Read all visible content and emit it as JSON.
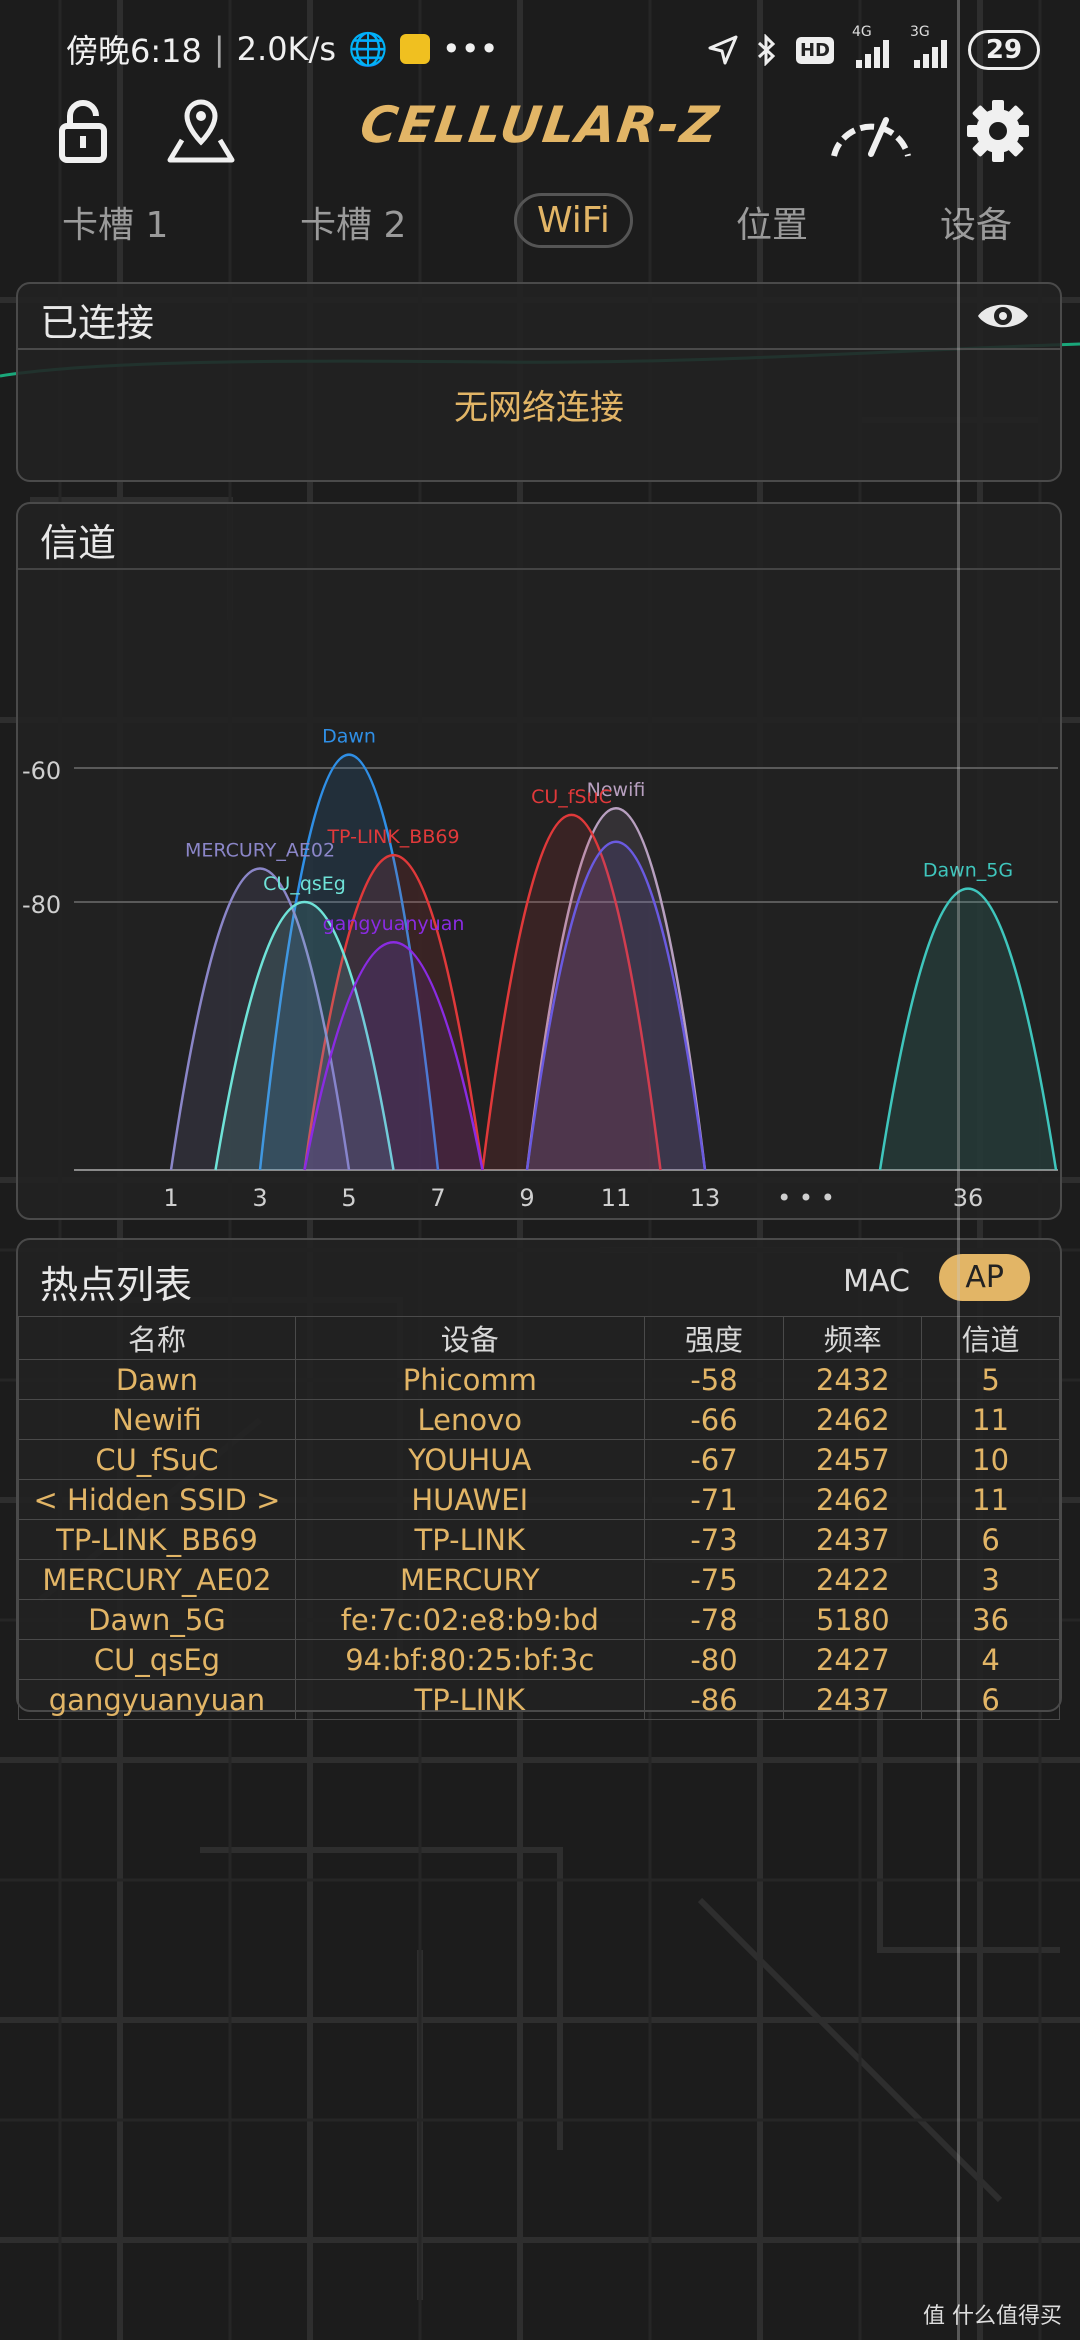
{
  "status_bar": {
    "time": "傍晚6:18",
    "net_speed": "2.0K/s",
    "more": "•••",
    "net1_label": "4G",
    "net2_label": "3G",
    "hd_label": "HD",
    "battery": "29"
  },
  "app": {
    "title": "CELLULAR-Z"
  },
  "tabs": [
    {
      "label": "卡槽 1"
    },
    {
      "label": "卡槽 2"
    },
    {
      "label": "WiFi"
    },
    {
      "label": "位置"
    },
    {
      "label": "设备"
    }
  ],
  "active_tab": "WiFi",
  "connected": {
    "title": "已连接",
    "status": "无网络连接"
  },
  "channel": {
    "title": "信道"
  },
  "chart_data": {
    "type": "area",
    "y_ticks": [
      "-60",
      "-80"
    ],
    "x_ticks": [
      "1",
      "3",
      "5",
      "7",
      "9",
      "11",
      "13",
      "• • •",
      "36"
    ],
    "y_range": [
      -100,
      -40
    ],
    "series": [
      {
        "name": "Dawn",
        "channel": 5,
        "rssi": -58,
        "color": "#2f8fe6"
      },
      {
        "name": "Newifi",
        "channel": 11,
        "rssi": -66,
        "color": "#b8a0c0"
      },
      {
        "name": "CU_fSuC",
        "channel": 10,
        "rssi": -67,
        "color": "#e0393a"
      },
      {
        "name": "",
        "channel": 11,
        "rssi": -71,
        "color": "#6a5ae0"
      },
      {
        "name": "TP-LINK_BB69",
        "channel": 6,
        "rssi": -73,
        "color": "#e0393a"
      },
      {
        "name": "MERCURY_AE02",
        "channel": 3,
        "rssi": -75,
        "color": "#8b86c8"
      },
      {
        "name": "Dawn_5G",
        "channel": 36,
        "rssi": -78,
        "color": "#3fc6bd"
      },
      {
        "name": "CU_qsEg",
        "channel": 4,
        "rssi": -80,
        "color": "#6fe3d8"
      },
      {
        "name": "gangyuanyuan",
        "channel": 6,
        "rssi": -86,
        "color": "#8a2be2"
      }
    ]
  },
  "hotspots": {
    "title": "热点列表",
    "mac_label": "MAC",
    "ap_label": "AP",
    "columns": [
      "名称",
      "设备",
      "强度",
      "频率",
      "信道"
    ],
    "rows": [
      [
        "Dawn",
        "Phicomm",
        "-58",
        "2432",
        "5"
      ],
      [
        "Newifi",
        "Lenovo",
        "-66",
        "2462",
        "11"
      ],
      [
        "CU_fSuC",
        "YOUHUA",
        "-67",
        "2457",
        "10"
      ],
      [
        "< Hidden SSID >",
        "HUAWEI",
        "-71",
        "2462",
        "11"
      ],
      [
        "TP-LINK_BB69",
        "TP-LINK",
        "-73",
        "2437",
        "6"
      ],
      [
        "MERCURY_AE02",
        "MERCURY",
        "-75",
        "2422",
        "3"
      ],
      [
        "Dawn_5G",
        "fe:7c:02:e8:b9:bd",
        "-78",
        "5180",
        "36"
      ],
      [
        "CU_qsEg",
        "94:bf:80:25:bf:3c",
        "-80",
        "2427",
        "4"
      ],
      [
        "gangyuanyuan",
        "TP-LINK",
        "-86",
        "2437",
        "6"
      ]
    ]
  },
  "watermark": "值 什么值得买"
}
